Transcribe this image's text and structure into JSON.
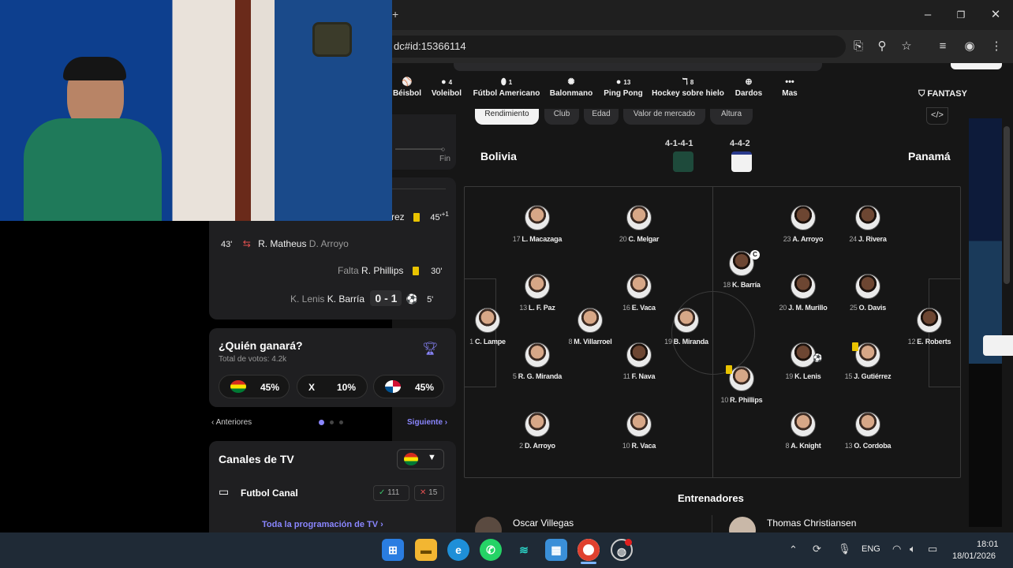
{
  "browser": {
    "url_fragment": "dc#id:15366114",
    "window_controls": {
      "minimize": "–",
      "maximize": "❐",
      "close": "✕"
    },
    "tab_add": "+"
  },
  "sports_nav": [
    {
      "label": "Béisbol",
      "count": "",
      "icon": "baseball-icon",
      "glyph": "⚾"
    },
    {
      "label": "Voleibol",
      "count": "4",
      "icon": "volleyball-icon",
      "glyph": "🏐"
    },
    {
      "label": "Fútbol Americano",
      "count": "1",
      "icon": "american-football-icon",
      "glyph": "🏈"
    },
    {
      "label": "Balonmano",
      "count": "",
      "icon": "handball-icon",
      "glyph": "⚽"
    },
    {
      "label": "Ping Pong",
      "count": "13",
      "icon": "ping-pong-icon",
      "glyph": "🏓"
    },
    {
      "label": "Hockey sobre hielo",
      "count": "8",
      "icon": "hockey-icon",
      "glyph": "🏒"
    },
    {
      "label": "Dardos",
      "count": "",
      "icon": "darts-icon",
      "glyph": "🎯"
    },
    {
      "label": "Mas",
      "count": "",
      "icon": "more-icon",
      "glyph": "•••"
    }
  ],
  "fantasy_label": "FANTASY",
  "filter_tabs": [
    "Rendimiento",
    "Club",
    "Edad",
    "Valor de mercado",
    "Altura"
  ],
  "lineup": {
    "home_team": "Bolivia",
    "away_team": "Panamá",
    "home_formation": "4-1-4-1",
    "away_formation": "4-4-2",
    "home_players": [
      {
        "num": "17",
        "name": "L. Macazaga"
      },
      {
        "num": "20",
        "name": "C. Melgar"
      },
      {
        "num": "13",
        "name": "L. F. Paz"
      },
      {
        "num": "16",
        "name": "E. Vaca"
      },
      {
        "num": "1",
        "name": "C. Lampe"
      },
      {
        "num": "8",
        "name": "M. Villarroel"
      },
      {
        "num": "19",
        "name": "B. Miranda"
      },
      {
        "num": "5",
        "name": "R. G. Miranda"
      },
      {
        "num": "11",
        "name": "F. Nava"
      },
      {
        "num": "2",
        "name": "D. Arroyo"
      },
      {
        "num": "10",
        "name": "R. Vaca"
      }
    ],
    "away_players": [
      {
        "num": "23",
        "name": "A. Arroyo"
      },
      {
        "num": "24",
        "name": "J. Rivera"
      },
      {
        "num": "18",
        "name": "K. Barría"
      },
      {
        "num": "20",
        "name": "J. M. Murillo"
      },
      {
        "num": "25",
        "name": "O. Davis"
      },
      {
        "num": "12",
        "name": "E. Roberts"
      },
      {
        "num": "19",
        "name": "K. Lenis"
      },
      {
        "num": "15",
        "name": "J. Gutiérrez"
      },
      {
        "num": "10",
        "name": "R. Phillips"
      },
      {
        "num": "8",
        "name": "A. Knight"
      },
      {
        "num": "13",
        "name": "O. Cordoba"
      }
    ]
  },
  "managers": {
    "title": "Entrenadores",
    "home": "Oscar Villegas",
    "away": "Thomas Christiansen"
  },
  "timeline": {
    "fin_label": "Fin",
    "events": [
      {
        "minute": "45'",
        "extra": "+1",
        "player_partial": "rez",
        "type": "yellow-card"
      },
      {
        "minute": "43'",
        "player_in": "R. Matheus",
        "player_out": "D. Arroyo",
        "type": "substitution"
      },
      {
        "minute": "30'",
        "prefix": "Falta",
        "player": "R. Phillips",
        "type": "yellow-card"
      },
      {
        "minute": "5'",
        "player_dim": "K. Lenis",
        "player": "K. Barría",
        "score": "0 - 1",
        "type": "goal"
      }
    ]
  },
  "prediction": {
    "title": "¿Quién ganará?",
    "votes": "Total de votos: 4.2k",
    "home_pct": "45%",
    "draw_label": "X",
    "draw_pct": "10%",
    "away_pct": "45%",
    "prev": "Anteriores",
    "next": "Siguiente"
  },
  "tv": {
    "title": "Canales de TV",
    "channel": "Futbol Canal",
    "yes_votes": "111",
    "no_votes": "15",
    "link": "Toda la programación de TV"
  },
  "taskbar": {
    "lang": "ENG",
    "time": "18:01",
    "date": "18/01/2026"
  },
  "colors": {
    "pitch_bg": "#1b1b1d",
    "accent_purple": "#8a86ff",
    "yellow_card": "#e9c300"
  }
}
